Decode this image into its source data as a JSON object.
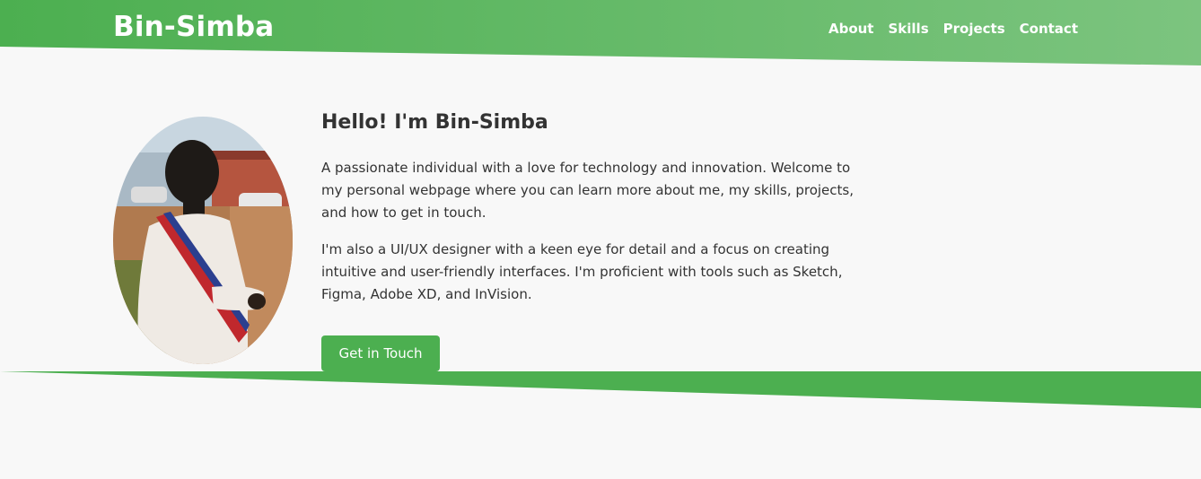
{
  "header": {
    "brand": "Bin-Simba",
    "nav": [
      {
        "label": "About"
      },
      {
        "label": "Skills"
      },
      {
        "label": "Projects"
      },
      {
        "label": "Contact"
      }
    ]
  },
  "hero": {
    "title": "Hello! I'm Bin-Simba",
    "paragraphs": [
      "A passionate individual with a love for technology and innovation. Welcome to my personal webpage where you can learn more about me, my skills, projects, and how to get in touch.",
      "I'm also a UI/UX designer with a keen eye for detail and a focus on creating intuitive and user-friendly interfaces. I'm proficient with tools such as Sketch, Figma, Adobe XD, and InVision."
    ],
    "cta_label": "Get in Touch"
  },
  "colors": {
    "accent": "#4caf50",
    "accent_light": "#7cc47f",
    "background": "#f8f8f8",
    "text": "#333333"
  },
  "icons": {
    "avatar": "profile-photo"
  }
}
